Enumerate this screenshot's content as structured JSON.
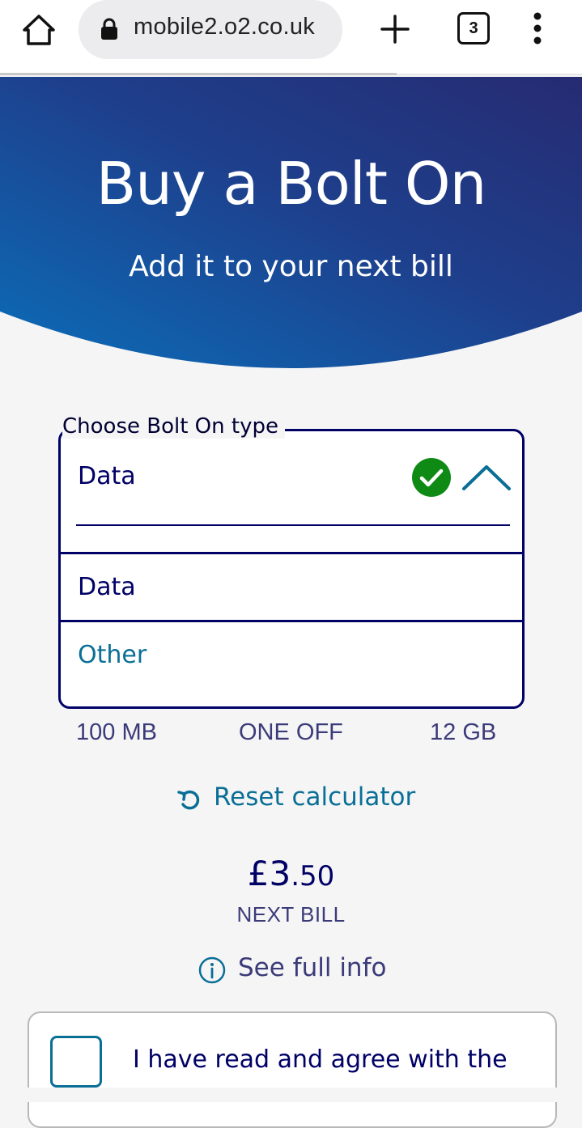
{
  "browser": {
    "url": "mobile2.o2.co.uk",
    "tab_count": "3",
    "icons": [
      "home-icon",
      "lock-icon",
      "plus-icon",
      "tabs-icon",
      "more-vert-icon"
    ]
  },
  "hero": {
    "title": "Buy a Bolt On",
    "subtitle": "Add it to your next bill",
    "gradient_colors": [
      "#0b6db8",
      "#262b72"
    ]
  },
  "bolt_on_select": {
    "legend": "Choose Bolt On type",
    "selected_value": "Data",
    "options": [
      {
        "label": "Data"
      },
      {
        "label": "Other"
      }
    ],
    "valid_color": "#0f8a14"
  },
  "scale": {
    "min_label": "100 MB",
    "mid_label": "ONE OFF",
    "max_label": "12 GB"
  },
  "reset": {
    "label": "Reset calculator"
  },
  "price": {
    "currency_whole": "£3",
    "decimal": ".50",
    "caption": "NEXT BILL"
  },
  "info": {
    "label": "See full info"
  },
  "terms": {
    "label": "I have read and agree with the"
  },
  "colors": {
    "navy": "#000066",
    "teal_link": "#0a6f96",
    "muted_navy": "#3b3b7a",
    "background": "#f5f5f5"
  }
}
